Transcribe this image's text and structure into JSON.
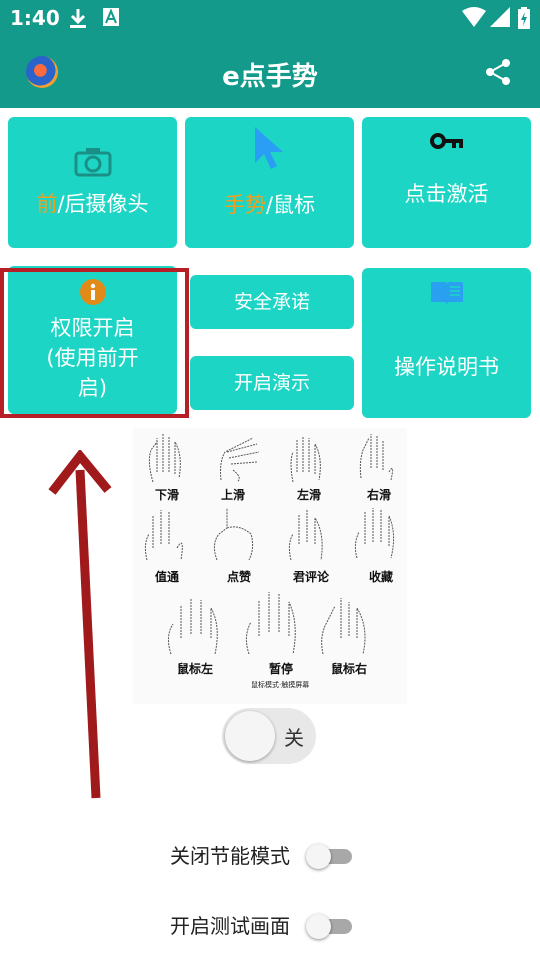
{
  "status_bar": {
    "time": "1:40",
    "icons": [
      "download-icon",
      "a-icon",
      "wifi-icon",
      "signal-icon",
      "battery-icon"
    ]
  },
  "app_bar": {
    "title": "e点手势",
    "logo_icon": "app-logo-icon",
    "share_icon": "share-icon"
  },
  "tiles": {
    "camera": {
      "highlight": "前",
      "rest": "/后摄像头",
      "icon": "camera-icon"
    },
    "gesture": {
      "highlight": "手势",
      "rest": "/鼠标",
      "icon": "cursor-icon"
    },
    "activate": {
      "label": "点击激活",
      "icon": "key-icon"
    },
    "permission": {
      "label": "权限开启\n(使用前开启)",
      "line1": "权限开启",
      "line2": "(使用前开",
      "line3": "启)",
      "icon": "info-icon"
    },
    "safety": {
      "label": "安全承诺"
    },
    "demo": {
      "label": "开启演示"
    },
    "manual": {
      "label": "操作说明书",
      "icon": "book-icon"
    }
  },
  "gestures": {
    "row1": [
      "下滑",
      "上滑",
      "左滑",
      "右滑"
    ],
    "row2": [
      "值通",
      "点赞",
      "君评论",
      "收藏"
    ],
    "row3": [
      "鼠标左",
      "暂停",
      "鼠标右"
    ],
    "note": "鼠标模式·触摸屏幕"
  },
  "main_toggle": {
    "label": "关",
    "state": "off"
  },
  "settings": [
    {
      "label": "关闭节能模式",
      "state": "off"
    },
    {
      "label": "开启测试画面",
      "state": "off"
    }
  ],
  "colors": {
    "primary": "#139a8a",
    "tile": "#1dd5c4",
    "accent_orange": "#f0a020",
    "highlight_red": "#b51f25"
  }
}
